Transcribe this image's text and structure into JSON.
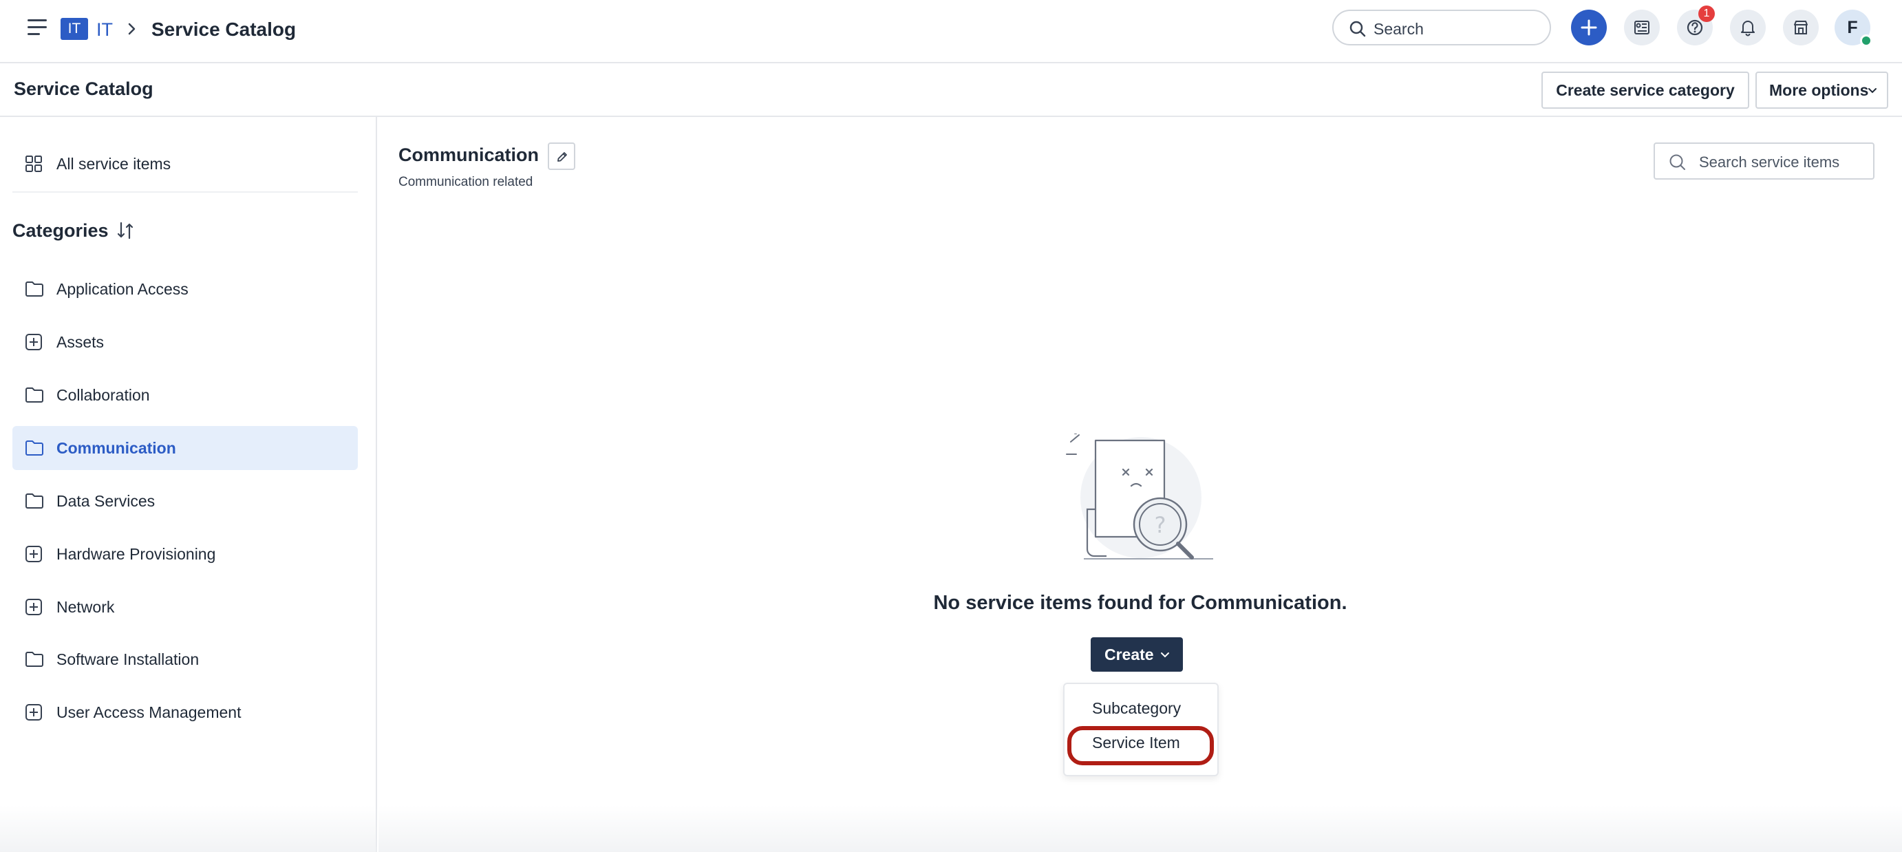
{
  "topbar": {
    "workspace_badge": "IT",
    "workspace_name": "IT",
    "page": "Service Catalog",
    "search_placeholder": "Search",
    "help_badge_count": "1",
    "avatar_initial": "F"
  },
  "subheader": {
    "title": "Service Catalog",
    "create_category_label": "Create service category",
    "more_options_label": "More options"
  },
  "sidebar": {
    "all_items_label": "All service items",
    "categories_heading": "Categories",
    "items": [
      {
        "label": "Application Access",
        "icon": "folder-icon"
      },
      {
        "label": "Assets",
        "icon": "plus-square-icon"
      },
      {
        "label": "Collaboration",
        "icon": "folder-icon"
      },
      {
        "label": "Communication",
        "icon": "folder-icon",
        "active": true
      },
      {
        "label": "Data Services",
        "icon": "folder-icon"
      },
      {
        "label": "Hardware Provisioning",
        "icon": "plus-square-icon"
      },
      {
        "label": "Network",
        "icon": "plus-square-icon"
      },
      {
        "label": "Software Installation",
        "icon": "folder-icon"
      },
      {
        "label": "User Access Management",
        "icon": "plus-square-icon"
      }
    ]
  },
  "main": {
    "title": "Communication",
    "subtitle": "Communication related",
    "search_placeholder": "Search service items",
    "empty_message": "No service items found for Communication.",
    "create_label": "Create",
    "dropdown": [
      "Subcategory",
      "Service Item"
    ]
  },
  "colors": {
    "accent": "#2c5cc5",
    "dark_button": "#22334d",
    "highlight": "#b01d14",
    "active_bg": "#e5eefb"
  }
}
